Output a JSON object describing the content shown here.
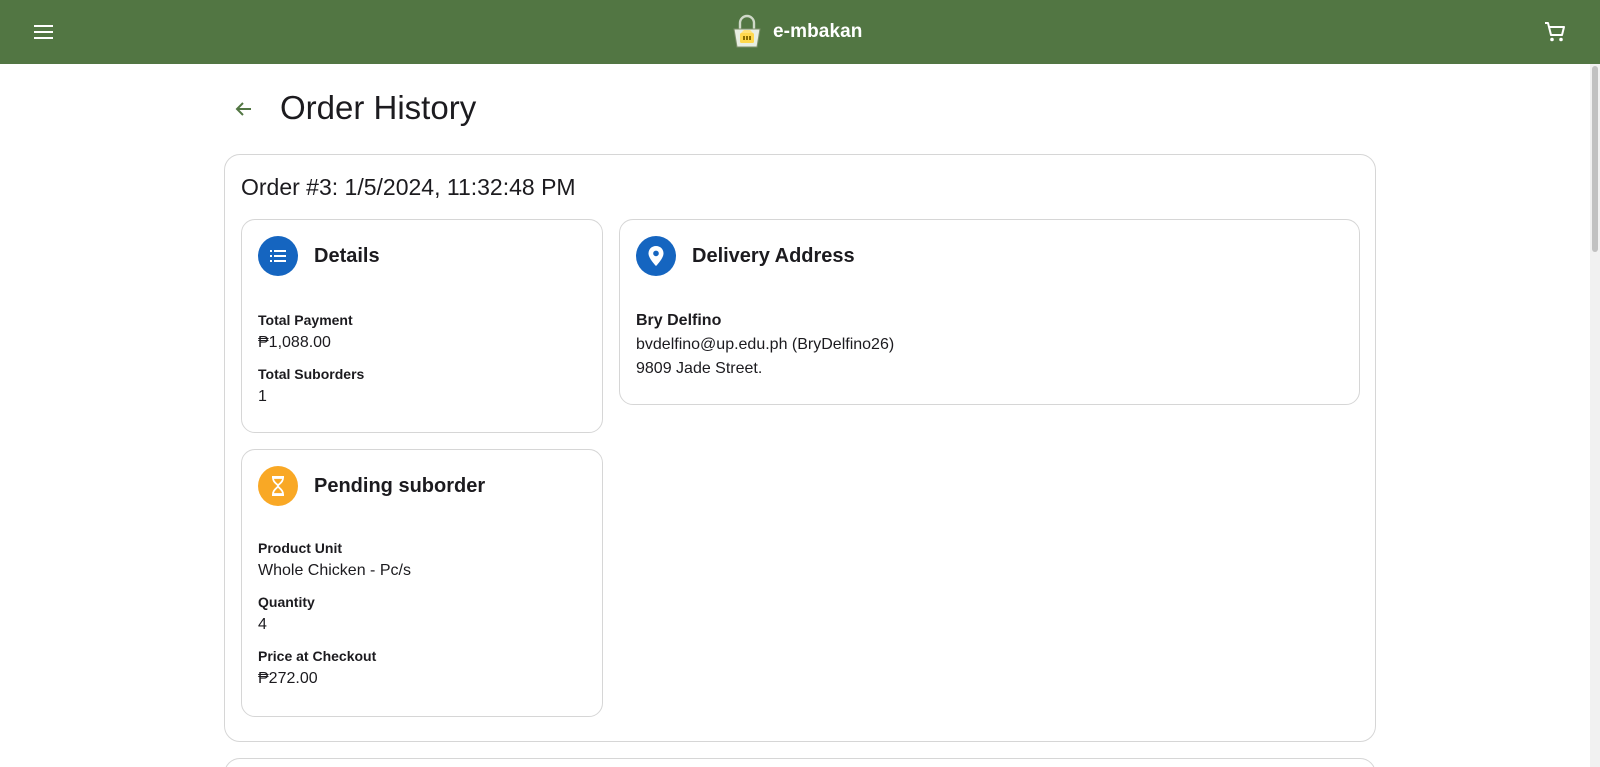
{
  "appbar": {
    "brand_name": "e-mbakan",
    "colors": {
      "background": "#527643",
      "text": "#ffffff"
    }
  },
  "page": {
    "title": "Order History"
  },
  "order": {
    "title": "Order #3: 1/5/2024, 11:32:48 PM",
    "details": {
      "title": "Details",
      "icon": "list-icon",
      "total_payment_label": "Total Payment",
      "total_payment_value": "₱1,088.00",
      "total_suborders_label": "Total Suborders",
      "total_suborders_value": "1"
    },
    "delivery": {
      "title": "Delivery Address",
      "icon": "location-pin-icon",
      "name": "Bry Delfino",
      "contact": "bvdelfino@up.edu.ph (BryDelfino26)",
      "street": "9809 Jade Street."
    },
    "suborder": {
      "title": "Pending suborder",
      "icon": "hourglass-icon",
      "product_unit_label": "Product Unit",
      "product_unit_value": "Whole Chicken - Pc/s",
      "quantity_label": "Quantity",
      "quantity_value": "4",
      "price_label": "Price at Checkout",
      "price_value": "₱272.00"
    }
  },
  "colors": {
    "accent_blue": "#1565c0",
    "pending_orange": "#f9a825",
    "border": "#d6d6d6"
  }
}
